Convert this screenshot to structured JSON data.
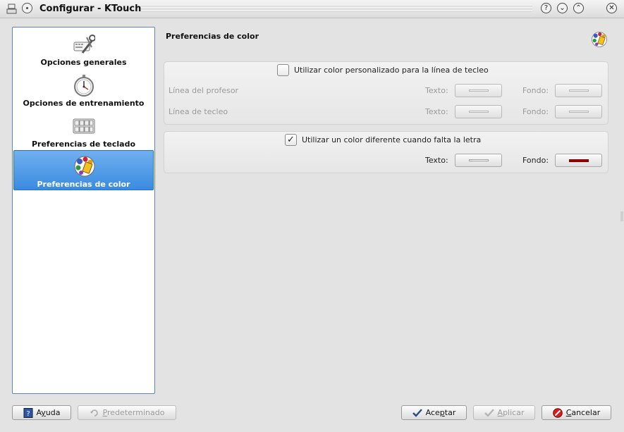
{
  "window": {
    "title": "Configurar - KTouch"
  },
  "titlebar": {
    "help_glyph": "?",
    "minimize_glyph": "⌄",
    "maximize_glyph": "⌃",
    "close_glyph": "✕"
  },
  "sidebar": {
    "items": [
      {
        "label": "Opciones generales",
        "icon": "general-options-icon",
        "active": false
      },
      {
        "label": "Opciones de entrenamiento",
        "icon": "stopwatch-icon",
        "active": false
      },
      {
        "label": "Preferencias de teclado",
        "icon": "keyboard-icon",
        "active": false
      },
      {
        "label": "Preferencias de color",
        "icon": "color-palette-icon",
        "active": true
      }
    ]
  },
  "main": {
    "title": "Preferencias de color",
    "group1": {
      "checkbox_label": "Utilizar color personalizado para la línea de tecleo",
      "checked": false,
      "rows": [
        {
          "label": "Línea del profesor",
          "text_label": "Texto:",
          "bg_label": "Fondo:"
        },
        {
          "label": "Línea de tecleo",
          "text_label": "Texto:",
          "bg_label": "Fondo:"
        }
      ]
    },
    "group2": {
      "checkbox_label": "Utilizar un color diferente cuando falta la letra",
      "checked": true,
      "check_glyph": "✓",
      "text_label": "Texto:",
      "bg_label": "Fondo:",
      "text_color": "#ffffff",
      "bg_color": "#a00000"
    }
  },
  "buttons": {
    "help": {
      "pre": "A",
      "u": "y",
      "post": "uda"
    },
    "defaults": {
      "pre": "",
      "u": "P",
      "post": "redeterminado"
    },
    "accept": {
      "pre": "Ace",
      "u": "p",
      "post": "tar"
    },
    "apply": {
      "pre": "",
      "u": "A",
      "post": "plicar"
    },
    "cancel": {
      "pre": "",
      "u": "C",
      "post": "ancelar"
    }
  },
  "colors": {
    "accent": "#3a8be0",
    "sidebar_border": "#5b84b7",
    "missing_letter_bg": "#a00000"
  }
}
